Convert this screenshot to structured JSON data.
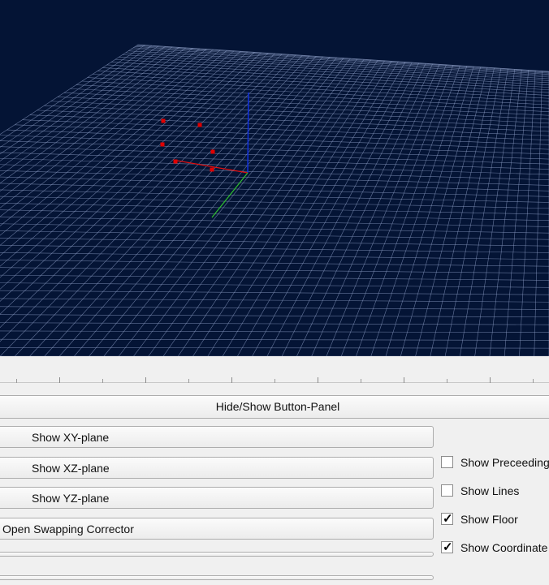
{
  "window": {
    "background_color": "#041435",
    "grid_color": "#8ea0c8"
  },
  "viewport": {
    "axis_colors": {
      "x": "#e01010",
      "y": "#30c030",
      "z": "#1030e0"
    },
    "point_color": "#e00000"
  },
  "panel": {
    "toggle_label": "Hide/Show Button-Panel",
    "buttons": [
      {
        "label": "Show XY-plane"
      },
      {
        "label": "Show XZ-plane"
      },
      {
        "label": "Show YZ-plane"
      },
      {
        "label": "Open Swapping Corrector"
      }
    ],
    "checkboxes": [
      {
        "label": "Show Preceeding",
        "checked": false
      },
      {
        "label": "Show Lines",
        "checked": false
      },
      {
        "label": "Show Floor",
        "checked": true
      },
      {
        "label": "Show Coordinate",
        "checked": true
      }
    ]
  }
}
